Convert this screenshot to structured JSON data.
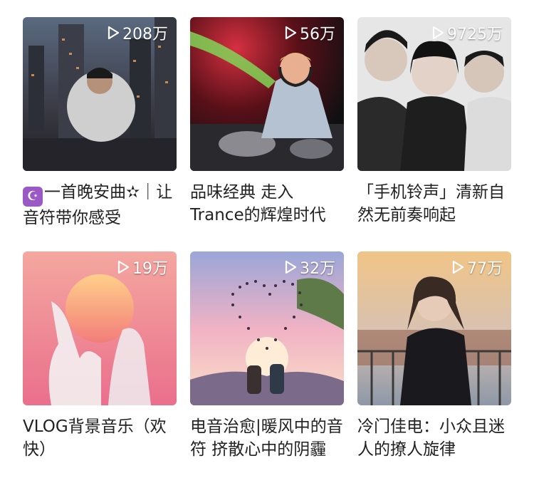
{
  "playlists": [
    {
      "plays": "208万",
      "title": "一首晚安曲✫｜让音符带你感受",
      "badge": "☪",
      "colors": [
        "#2c2f3a",
        "#6b5a48"
      ]
    },
    {
      "plays": "56万",
      "title": "品味经典 走入Trance的辉煌时代",
      "colors": [
        "#1a1a1c",
        "#c21f30"
      ]
    },
    {
      "plays": "9725万",
      "title": "「手机铃声」清新自然无前奏响起",
      "colors": [
        "#e8e8e8",
        "#6d6d6d"
      ]
    },
    {
      "plays": "19万",
      "title": "VLOG背景音乐（欢快）",
      "colors": [
        "#f7b0a4",
        "#e86c8a"
      ]
    },
    {
      "plays": "32万",
      "title": "电音治愈|暖风中的音符 挤散心中的阴霾",
      "colors": [
        "#f0b9c8",
        "#8fa0d4"
      ]
    },
    {
      "plays": "77万",
      "title": "冷门佳电：小众且迷人的撩人旋律",
      "colors": [
        "#f5c98a",
        "#a7b3c2"
      ]
    }
  ]
}
